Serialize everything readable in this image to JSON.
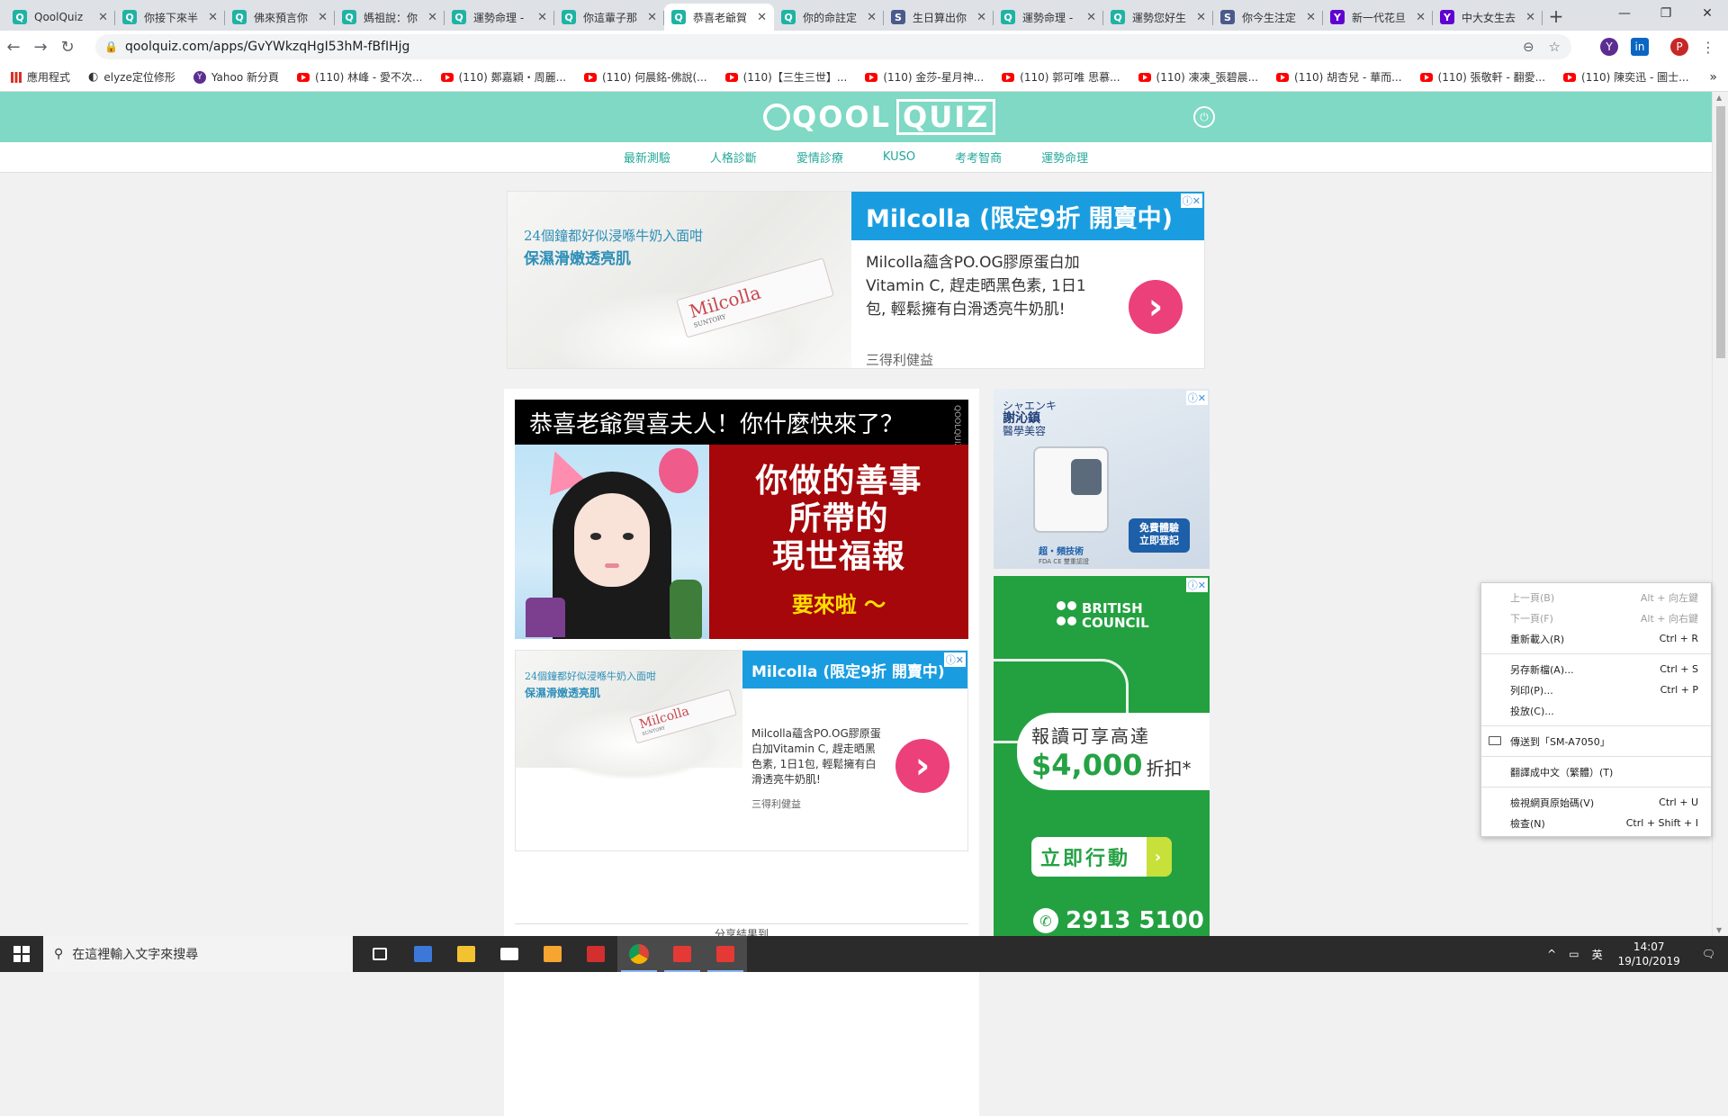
{
  "browser": {
    "tabs": [
      {
        "favicon": "Q",
        "favicon_type": "q",
        "title": "QoolQuiz"
      },
      {
        "favicon": "Q",
        "favicon_type": "q",
        "title": "你接下來半"
      },
      {
        "favicon": "Q",
        "favicon_type": "q",
        "title": "佛來預言你"
      },
      {
        "favicon": "Q",
        "favicon_type": "q",
        "title": "媽祖說：你"
      },
      {
        "favicon": "Q",
        "favicon_type": "q",
        "title": "運勢命理 -"
      },
      {
        "favicon": "Q",
        "favicon_type": "q",
        "title": "你這輩子那"
      },
      {
        "favicon": "Q",
        "favicon_type": "q",
        "title": "恭喜老爺賀",
        "active": true
      },
      {
        "favicon": "Q",
        "favicon_type": "q",
        "title": "你的命註定"
      },
      {
        "favicon": "S",
        "favicon_type": "s",
        "title": "生日算出你"
      },
      {
        "favicon": "Q",
        "favicon_type": "q",
        "title": "運勢命理 -"
      },
      {
        "favicon": "Q",
        "favicon_type": "q",
        "title": "運勢您好生"
      },
      {
        "favicon": "S",
        "favicon_type": "s",
        "title": "你今生注定"
      },
      {
        "favicon": "Y",
        "favicon_type": "y",
        "title": "新一代花旦"
      },
      {
        "favicon": "Y",
        "favicon_type": "y",
        "title": "中大女生去"
      }
    ],
    "new_tab": "+",
    "window_controls": {
      "minimize": "—",
      "maximize": "❐",
      "close": "✕"
    },
    "nav": {
      "back": "←",
      "forward": "→",
      "reload": "↻"
    },
    "url": "qoolquiz.com/apps/GvYWkzqHgI53hM-fBfIHjg",
    "lock_icon": "🔒",
    "zoom_icon": "⊖",
    "star_icon": "☆",
    "extensions": [
      {
        "label": "Y",
        "color": "#5c2d91"
      },
      {
        "label": "in",
        "color": "#0a66c2",
        "badge": "5"
      },
      {
        "label": "P",
        "color": "#c62828"
      }
    ],
    "menu_icon": "⋮",
    "bookmarks": [
      {
        "icon": "apps",
        "label": "應用程式"
      },
      {
        "icon": "globe",
        "label": "elyze定位修形"
      },
      {
        "icon": "yahoo",
        "label": "Yahoo 新分頁"
      },
      {
        "icon": "yt",
        "label": "(110) 林峰 - 愛不次..."
      },
      {
        "icon": "yt",
        "label": "(110) 鄭嘉穎・周麗..."
      },
      {
        "icon": "yt",
        "label": "(110) 何晨銘-佛說(..."
      },
      {
        "icon": "yt",
        "label": "(110)【三生三世】..."
      },
      {
        "icon": "yt",
        "label": "(110) 金莎-星月神..."
      },
      {
        "icon": "yt",
        "label": "(110) 郭可唯 思慕..."
      },
      {
        "icon": "yt",
        "label": "(110) 凍凍_張碧晨..."
      },
      {
        "icon": "yt",
        "label": "(110) 胡杏兒 - 華而..."
      },
      {
        "icon": "yt",
        "label": "(110) 張敬軒 - 翻愛..."
      },
      {
        "icon": "yt",
        "label": "(110) 陳奕迅 - 圖士..."
      }
    ],
    "bookmarks_more": "»"
  },
  "site": {
    "logo_text": "QOOL",
    "logo_box": "QUIZ",
    "power_icon": "⏻",
    "nav": [
      "最新測驗",
      "人格診斷",
      "愛情診療",
      "KUSO",
      "考考智商",
      "運勢命理"
    ]
  },
  "top_ad": {
    "tagline1": "24個鐘都好似浸喺牛奶入面咁",
    "tagline2": "保濕滑嫩透亮肌",
    "product": "Milcolla",
    "product_note": "高濃度PO.OGコラーゲン配合",
    "brand_mark": "SUNTORY",
    "headline": "Milcolla (限定9折 開賣中)",
    "body": "Milcolla蘊含PO.OG膠原蛋白加Vitamin C, 趕走晒黑色素, 1日1包, 輕鬆擁有白滑透亮牛奶肌!",
    "source": "三得利健益",
    "arrow": "›",
    "adchoice": "ⓘ✕"
  },
  "quiz": {
    "title": "恭喜老爺賀喜夫人！你什麼快來了？",
    "watermark": "QOOLQUIZ",
    "result_line1": "你做的善事",
    "result_line2": "所帶的",
    "result_line3": "現世福報",
    "result_sub": "要來啦 〜",
    "share_label": "分享結果到"
  },
  "mid_ad": {
    "tagline1": "24個鐘都好似浸喺牛奶入面咁",
    "tagline2": "保濕滑嫩透亮肌",
    "product": "Milcolla",
    "brand_mark": "SUNTORY",
    "headline": "Milcolla (限定9折 開賣中)",
    "body": "Milcolla蘊含PO.OG膠原蛋白加Vitamin C, 趕走晒黑色素, 1日1包, 輕鬆擁有白滑透亮牛奶肌!",
    "source": "三得利健益",
    "arrow": "›",
    "adchoice": "ⓘ✕"
  },
  "right_ad1": {
    "brand_jp": "シャエンキ",
    "brand_zh": "謝沁鎮",
    "brand_sub": "醫學美容",
    "tech": "超・頻技術",
    "tech_sub": "FDA CE 雙重認證",
    "cta1": "免費體驗",
    "cta2": "立即登記",
    "adchoice": "ⓘ✕"
  },
  "right_ad2": {
    "logo1": "BRITISH",
    "logo2": "COUNCIL",
    "offer_l1": "報讀可享高達",
    "offer_amount": "$4,000",
    "offer_suffix": "折扣*",
    "button": "立即行動",
    "button_chev": "›",
    "phone": "2913 5100",
    "phone_icon": "✆",
    "adchoice": "ⓘ✕"
  },
  "context_menu": {
    "items": [
      {
        "label": "上一頁(B)",
        "shortcut": "Alt + 向左鍵",
        "disabled": true
      },
      {
        "label": "下一頁(F)",
        "shortcut": "Alt + 向右鍵",
        "disabled": true
      },
      {
        "label": "重新載入(R)",
        "shortcut": "Ctrl + R"
      },
      {
        "label": "另存新檔(A)...",
        "shortcut": "Ctrl + S"
      },
      {
        "label": "列印(P)...",
        "shortcut": "Ctrl + P"
      },
      {
        "label": "投放(C)...",
        "shortcut": ""
      },
      {
        "label": "傳送到「SM-A7050」",
        "shortcut": ""
      },
      {
        "label": "翻譯成中文（繁體）(T)",
        "shortcut": ""
      },
      {
        "label": "檢視網頁原始碼(V)",
        "shortcut": "Ctrl + U"
      },
      {
        "label": "檢查(N)",
        "shortcut": "Ctrl + Shift + I"
      }
    ]
  },
  "taskbar": {
    "search_placeholder": "在這裡輸入文字來搜尋",
    "search_icon": "⚲",
    "tray_caret": "^",
    "ime": "英",
    "time": "14:07",
    "date": "19/10/2019",
    "notification_icon": "🗨"
  }
}
